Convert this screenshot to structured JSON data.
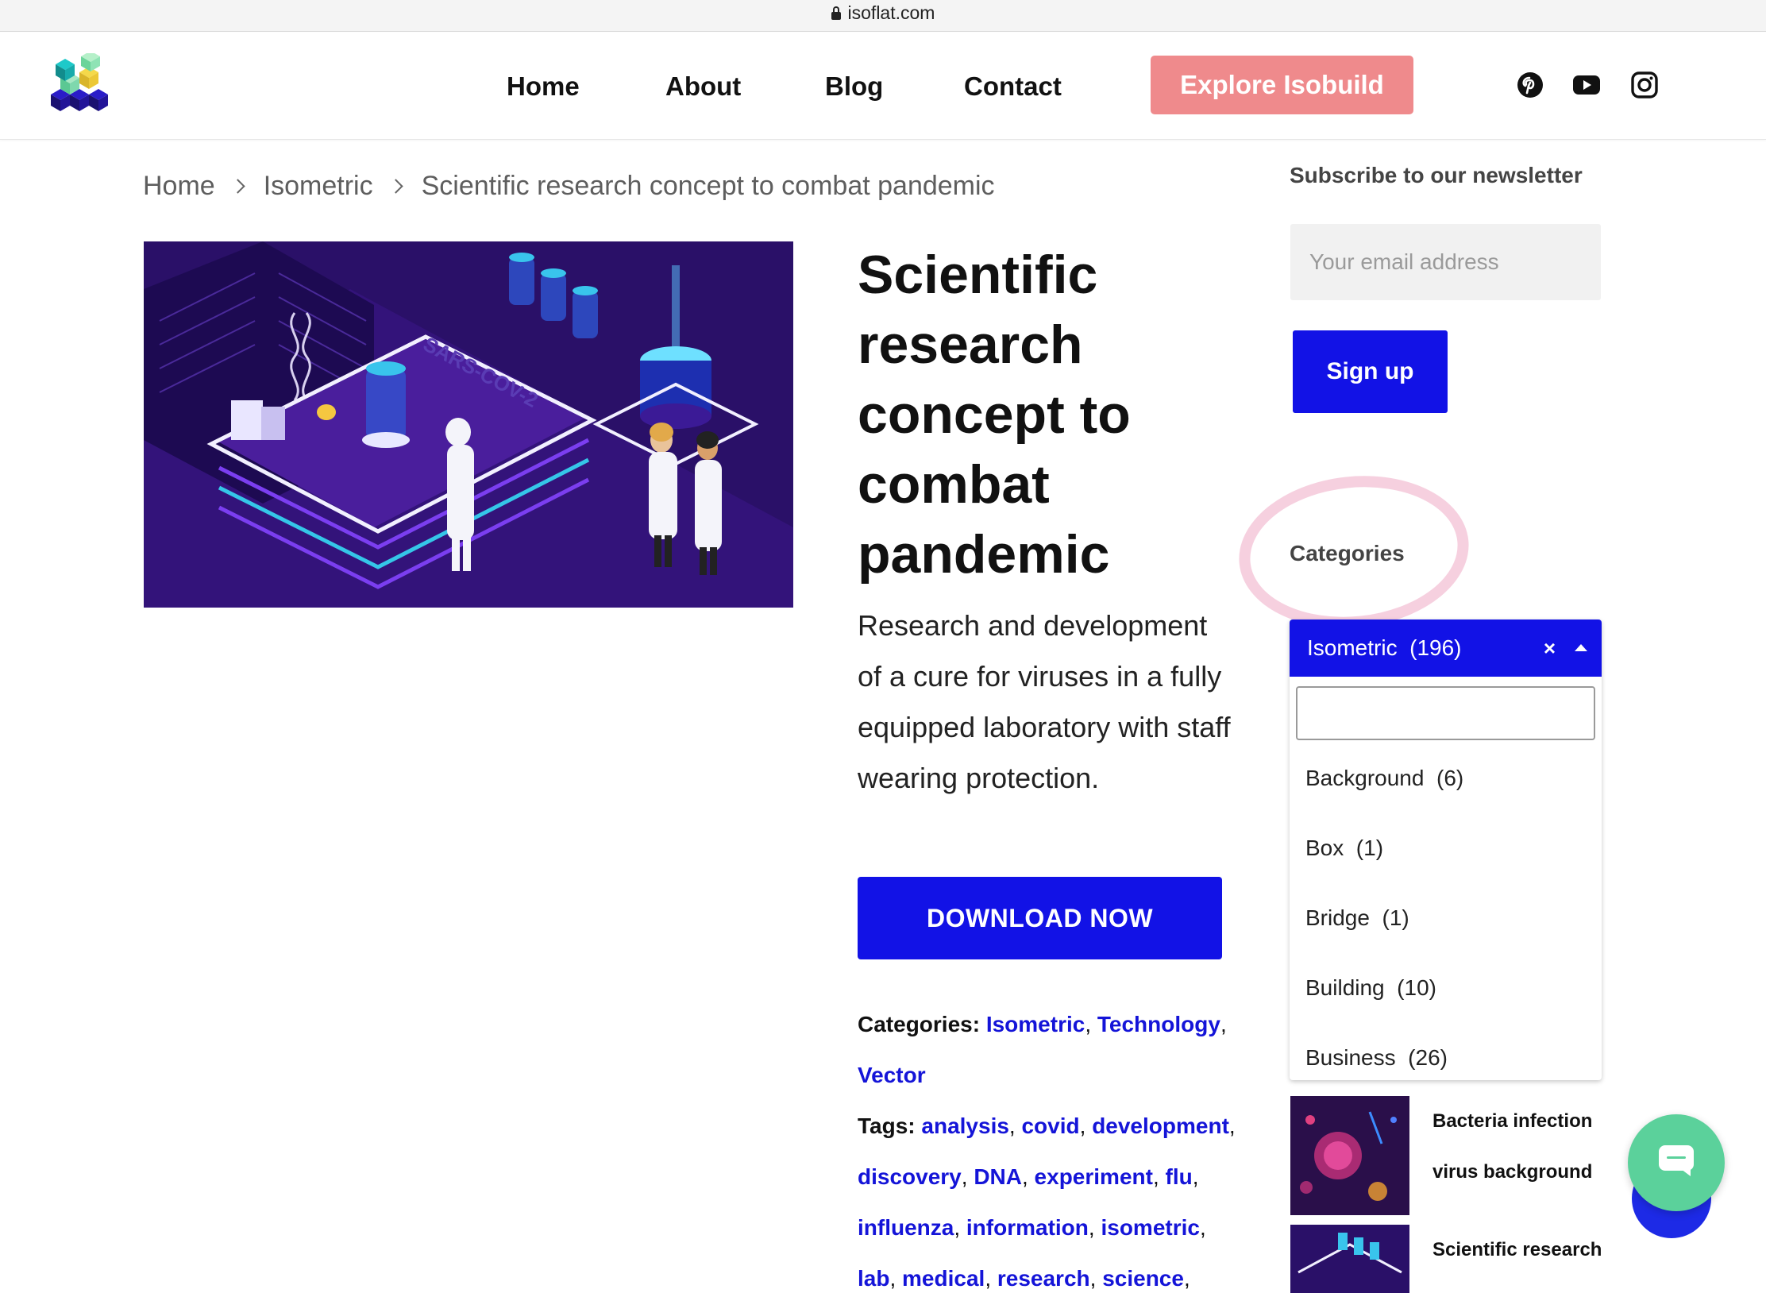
{
  "browser": {
    "url": "isoflat.com"
  },
  "header": {
    "nav": [
      {
        "label": "Home"
      },
      {
        "label": "About"
      },
      {
        "label": "Blog"
      },
      {
        "label": "Contact"
      }
    ],
    "cta_label": "Explore Isobuild",
    "social_icons": [
      "pinterest-icon",
      "youtube-icon",
      "instagram-icon"
    ]
  },
  "breadcrumb": [
    "Home",
    "Isometric",
    "Scientific research concept to combat pandemic"
  ],
  "article": {
    "title": "Scientific research concept to combat pandemic",
    "description": "Research and development of a cure for viruses in a fully equipped laboratory with staff wearing protection.",
    "download_label": "DOWNLOAD NOW",
    "categories_label": "Categories:",
    "categories": [
      "Isometric",
      "Technology",
      "Vector"
    ],
    "tags_label": "Tags:",
    "tags": [
      "analysis",
      "covid",
      "development",
      "discovery",
      "DNA",
      "experiment",
      "flu",
      "influenza",
      "information",
      "isometric",
      "lab",
      "medical",
      "research",
      "science"
    ]
  },
  "sidebar": {
    "newsletter_heading": "Subscribe to our newsletter",
    "email_placeholder": "Your email address",
    "signup_label": "Sign up",
    "categories_heading": "Categories",
    "dropdown": {
      "selected": "Isometric  (196)",
      "clear": "×",
      "search_value": "",
      "options": [
        "Background  (6)",
        "Box  (1)",
        "Bridge  (1)",
        "Building  (10)",
        "Business  (26)"
      ]
    },
    "related": [
      {
        "title": "Bacteria infection virus background"
      },
      {
        "title": "Scientific research"
      }
    ]
  },
  "colors": {
    "primary_blue": "#1212e6",
    "explore_pink": "#ef8a8c",
    "chat_green": "#5bd19b",
    "link_blue": "#1414d8",
    "hero_purple": "#2a1068"
  }
}
